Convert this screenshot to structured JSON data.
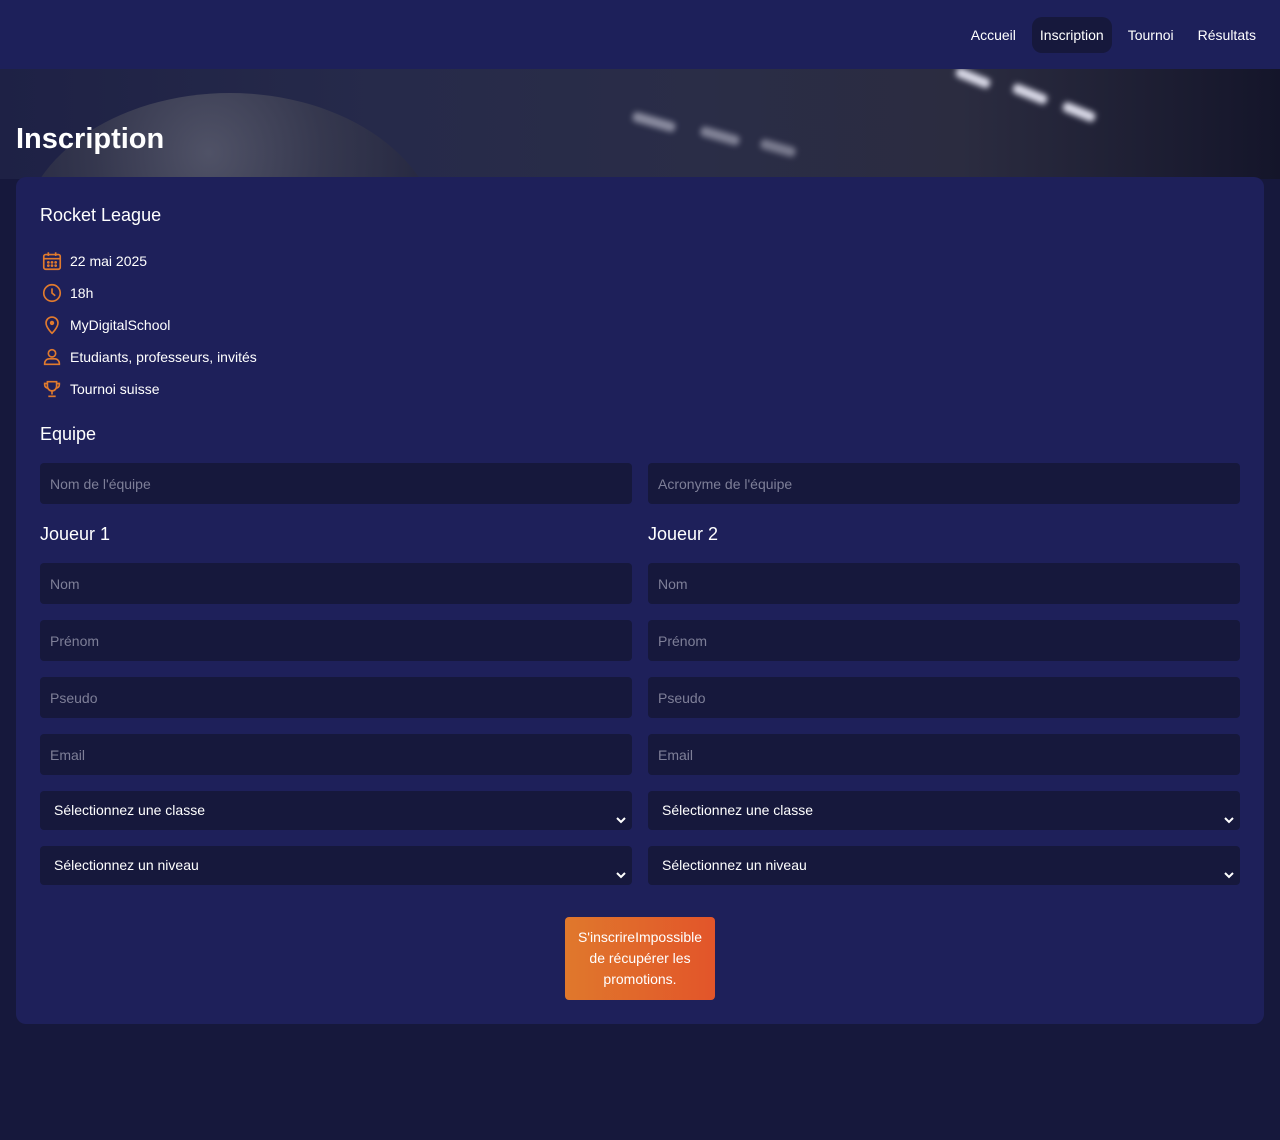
{
  "nav": {
    "items": [
      {
        "label": "Accueil"
      },
      {
        "label": "Inscription"
      },
      {
        "label": "Tournoi"
      },
      {
        "label": "Résultats"
      }
    ],
    "active": "Inscription"
  },
  "page": {
    "title": "Inscription"
  },
  "event": {
    "game": "Rocket League",
    "date": "22 mai 2025",
    "time": "18h",
    "location": "MyDigitalSchool",
    "audience": "Etudiants, professeurs, invités",
    "format": "Tournoi suisse"
  },
  "team": {
    "heading": "Equipe",
    "name_placeholder": "Nom de l'équipe",
    "acronym_placeholder": "Acronyme de l'équipe"
  },
  "players": [
    {
      "heading": "Joueur 1",
      "lastname_placeholder": "Nom",
      "firstname_placeholder": "Prénom",
      "pseudo_placeholder": "Pseudo",
      "email_placeholder": "Email",
      "class_select": "Sélectionnez une classe",
      "level_select": "Sélectionnez un niveau"
    },
    {
      "heading": "Joueur 2",
      "lastname_placeholder": "Nom",
      "firstname_placeholder": "Prénom",
      "pseudo_placeholder": "Pseudo",
      "email_placeholder": "Email",
      "class_select": "Sélectionnez une classe",
      "level_select": "Sélectionnez un niveau"
    }
  ],
  "submit": {
    "label": "S'inscrireImpossible de récupérer les promotions."
  },
  "colors": {
    "background": "#16183c",
    "navbar": "#1d205a",
    "card": "#1e205a",
    "input": "#16183c",
    "accent": "#e07a2e",
    "button_start": "#e0782c",
    "button_end": "#e2552a"
  }
}
